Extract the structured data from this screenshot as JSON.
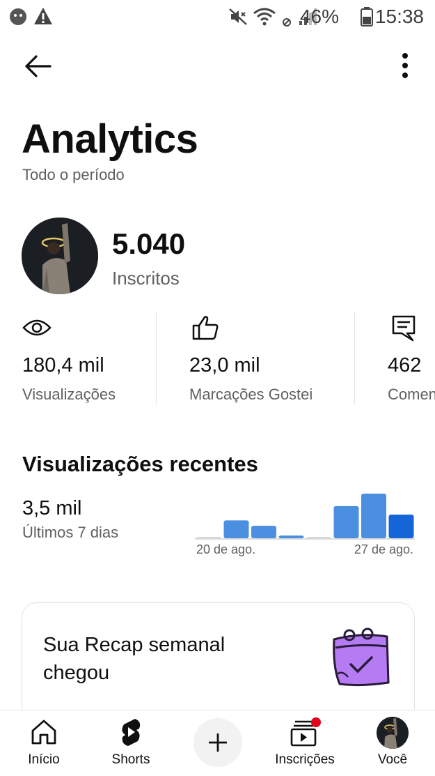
{
  "status_bar": {
    "battery_percent": "46%",
    "time": "15:38"
  },
  "header": {
    "back_label": "Voltar",
    "title": "Analytics",
    "period": "Todo o período"
  },
  "channel": {
    "subscribers_value": "5.040",
    "subscribers_label": "Inscritos"
  },
  "stats": [
    {
      "value": "180,4 mil",
      "label": "Visualizações",
      "icon": "eye-icon"
    },
    {
      "value": "23,0 mil",
      "label": "Marcações Gostei",
      "icon": "thumbs-up-icon"
    },
    {
      "value": "462",
      "label": "Comentários",
      "icon": "comment-icon"
    }
  ],
  "recent": {
    "title": "Visualizações recentes",
    "value": "3,5 mil",
    "period": "Últimos 7 dias"
  },
  "chart_data": {
    "type": "bar",
    "categories": [
      "",
      "",
      "",
      "",
      "",
      "",
      "",
      ""
    ],
    "values": [
      0.02,
      0.4,
      0.28,
      0.06,
      0.03,
      0.72,
      1.0,
      0.53
    ],
    "x_tick_labels": [
      "20 de ago.",
      "27 de ago."
    ],
    "colors": {
      "bar": "#4a8fe0",
      "highlight": "#1565d8"
    }
  },
  "recap": {
    "text": "Sua Recap semanal chegou"
  },
  "bottom_nav": [
    {
      "label": "Início",
      "icon": "home-icon"
    },
    {
      "label": "Shorts",
      "icon": "shorts-icon"
    },
    {
      "label": "",
      "icon": "create-icon"
    },
    {
      "label": "Inscrições",
      "icon": "subscriptions-icon"
    },
    {
      "label": "Você",
      "icon": "avatar"
    }
  ]
}
